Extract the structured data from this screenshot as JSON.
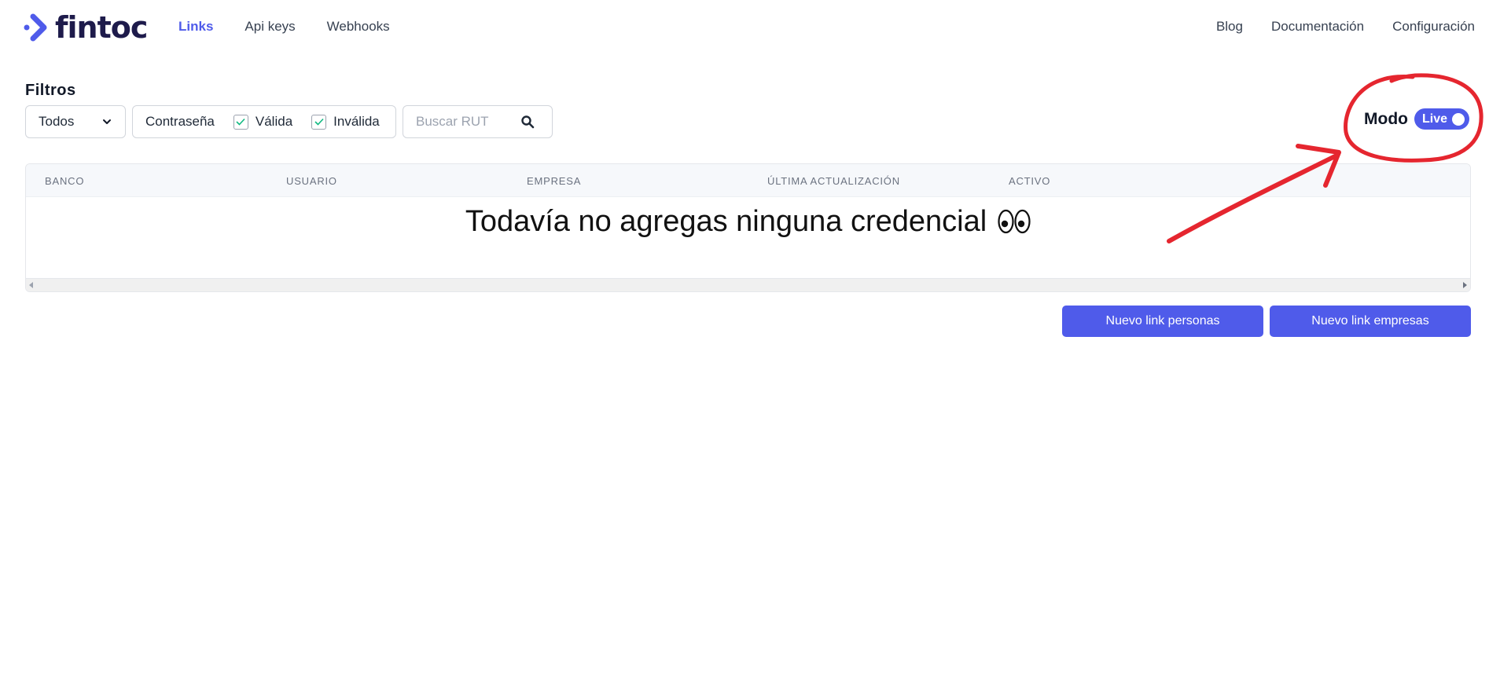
{
  "brand": {
    "name": "fintoc",
    "accent": "#4f5bea",
    "dark": "#1e1b4b"
  },
  "nav": {
    "left": [
      {
        "label": "Links",
        "active": true
      },
      {
        "label": "Api keys",
        "active": false
      },
      {
        "label": "Webhooks",
        "active": false
      }
    ],
    "right": [
      {
        "label": "Blog"
      },
      {
        "label": "Documentación"
      },
      {
        "label": "Configuración"
      }
    ]
  },
  "filters": {
    "title": "Filtros",
    "status_select": {
      "value": "Todos",
      "icon": "chevron-down-icon"
    },
    "password": {
      "label": "Contraseña",
      "options": [
        {
          "label": "Válida",
          "checked": true
        },
        {
          "label": "Inválida",
          "checked": true
        }
      ]
    },
    "search": {
      "placeholder": "Buscar RUT",
      "value": "",
      "icon": "search-icon"
    }
  },
  "mode": {
    "label": "Modo",
    "toggle_label": "Live",
    "on": true
  },
  "annotation": {
    "color": "#e5262f",
    "shapes": [
      "circle-around-mode-toggle",
      "arrow-pointing-to-toggle"
    ]
  },
  "table": {
    "columns": [
      "BANCO",
      "USUARIO",
      "EMPRESA",
      "ÚLTIMA ACTUALIZACIÓN",
      "ACTIVO"
    ],
    "rows": [],
    "empty_message": "Todavía no agregas ninguna credencial",
    "empty_emoji": "eyes-icon"
  },
  "actions": {
    "new_persons": "Nuevo link personas",
    "new_companies": "Nuevo link empresas"
  }
}
